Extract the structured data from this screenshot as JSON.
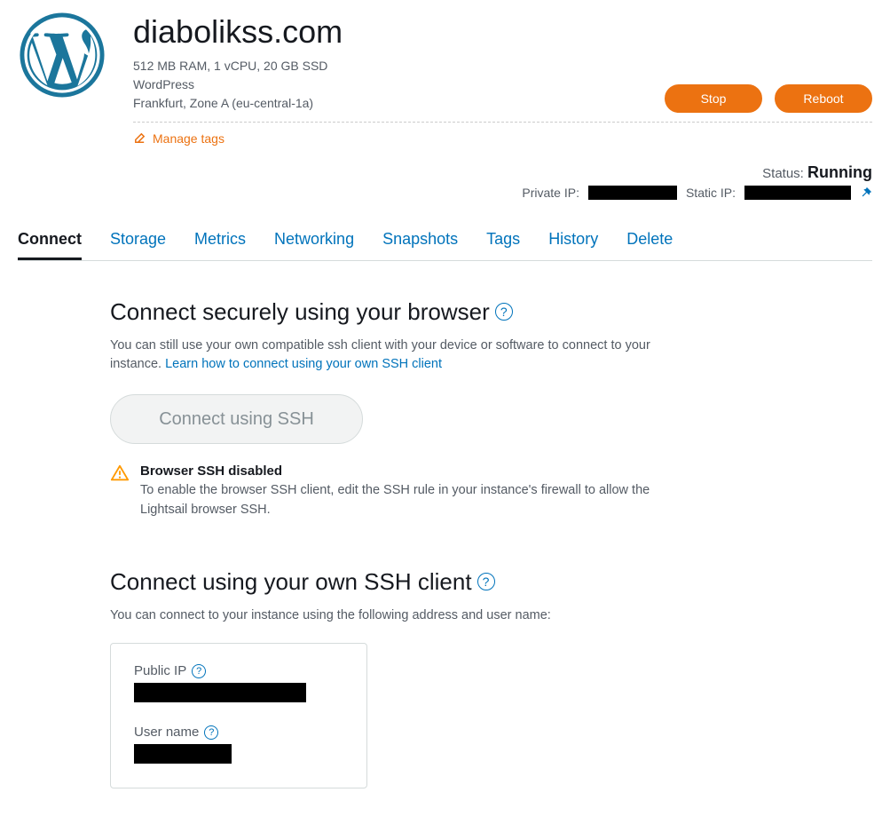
{
  "header": {
    "instance_name": "diabolikss.com",
    "instance_specs": "512 MB RAM, 1 vCPU, 20 GB SSD",
    "app_name": "WordPress",
    "zone_text": "Frankfurt, Zone A (eu-central-1a)",
    "manage_tags_label": "Manage tags",
    "stop_label": "Stop",
    "reboot_label": "Reboot"
  },
  "status": {
    "status_label": "Status:",
    "status_value": "Running",
    "private_ip_label": "Private IP:",
    "static_ip_label": "Static IP:"
  },
  "tabs": [
    {
      "label": "Connect",
      "active": true
    },
    {
      "label": "Storage",
      "active": false
    },
    {
      "label": "Metrics",
      "active": false
    },
    {
      "label": "Networking",
      "active": false
    },
    {
      "label": "Snapshots",
      "active": false
    },
    {
      "label": "Tags",
      "active": false
    },
    {
      "label": "History",
      "active": false
    },
    {
      "label": "Delete",
      "active": false
    }
  ],
  "connect": {
    "browser_heading": "Connect securely using your browser",
    "browser_desc": "You can still use your own compatible ssh client with your device or software to connect to your instance. ",
    "browser_learn_link": "Learn how to connect using your own SSH client",
    "ssh_button": "Connect using SSH",
    "warn_title": "Browser SSH disabled",
    "warn_body": "To enable the browser SSH client, edit the SSH rule in your instance's firewall to allow the Lightsail browser SSH.",
    "own_heading": "Connect using your own SSH client",
    "own_desc": "You can connect to your instance using the following address and user name:",
    "public_ip_label": "Public IP",
    "user_name_label": "User name"
  },
  "help_glyph": "?"
}
